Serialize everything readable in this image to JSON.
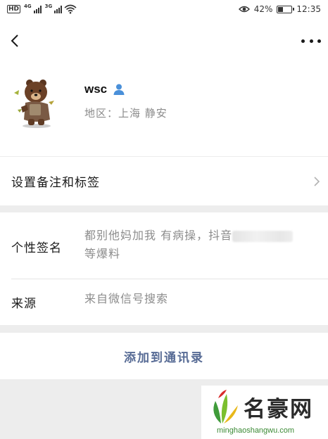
{
  "status_bar": {
    "hd_badge": "HD",
    "net_1": "4G",
    "net_2": "3G",
    "battery_percent_label": "42%",
    "battery_level": 0.42,
    "time": "12:35"
  },
  "profile": {
    "name": "wsc",
    "region": "地区：上海 静安"
  },
  "remark_row": {
    "label": "设置备注和标签"
  },
  "signature": {
    "label": "个性签名",
    "text_prefix": "都别他妈加我 有病操，抖音",
    "text_suffix": "等爆料"
  },
  "source": {
    "label": "来源",
    "text": "来自微信号搜索"
  },
  "add_contact": {
    "label": "添加到通讯录"
  },
  "watermark": {
    "title": "名豪网",
    "url": "minghaoshangwu.com"
  },
  "colors": {
    "background": "#ededed",
    "link_blue": "#576b95",
    "secondary_text": "#8c8c8c",
    "person_icon": "#4a90d9"
  },
  "icons": [
    "eye-icon",
    "wifi-icon",
    "battery-icon",
    "back-arrow-icon",
    "more-dots-icon",
    "person-icon",
    "chevron-right-icon"
  ]
}
